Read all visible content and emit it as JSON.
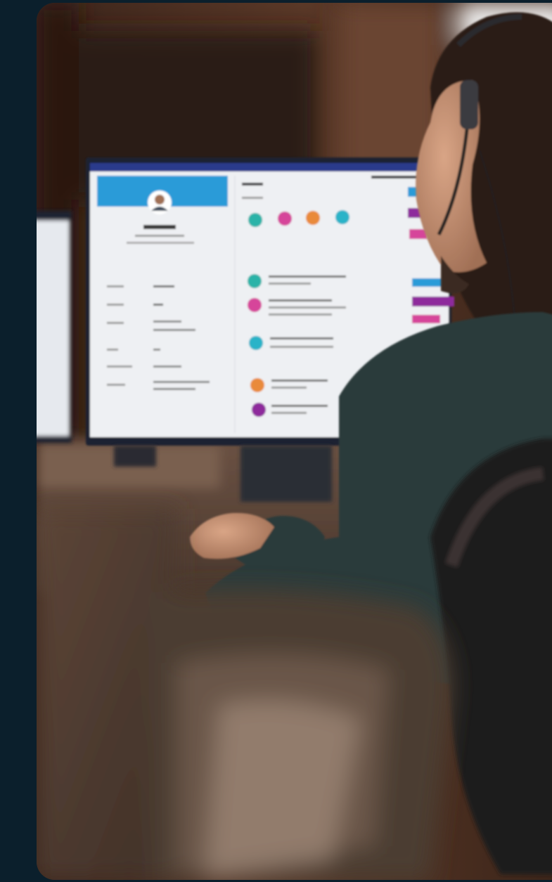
{
  "photo": {
    "subject": "customer-service-agent-with-headset",
    "colors": {
      "page_background": "#0b1f2c",
      "wood_wall": "#4a2f22",
      "monitor_screen": "#eef0f3",
      "profile_header": "#2a9bd8",
      "accent_teal": "#2bb3a8",
      "accent_pink": "#d6449a",
      "accent_orange": "#e98a3a",
      "accent_cyan": "#2ab3c8",
      "accent_purple": "#8e2c9c",
      "sweater": "#2c3b3b"
    }
  }
}
